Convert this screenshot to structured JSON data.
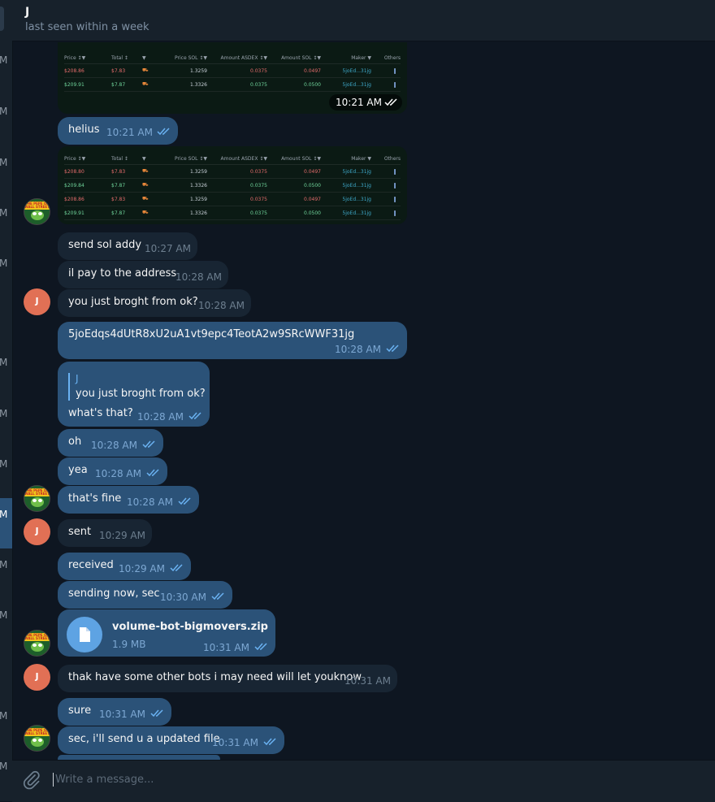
{
  "chat": {
    "name": "J",
    "status": "last seen within a week"
  },
  "composer": {
    "placeholder": "Write a message..."
  },
  "left_strip_marks": [
    "M",
    "M",
    "M",
    "M",
    "M",
    "M",
    "M",
    "M",
    "M",
    "M",
    "M",
    "M",
    "M"
  ],
  "image1": {
    "time": "10:21 AM",
    "headers": [
      "Price ↕▼",
      "Total ↕",
      "▼",
      "Price SOL ↕▼",
      "Amount ASDEX ↕▼",
      "Amount SOL ↕▼",
      "Maker ▼",
      "Others"
    ],
    "rows": [
      {
        "price": "$208.86",
        "total": "$7.83",
        "price_sol": "1.3259",
        "amount_asdex": "0.0375",
        "amount_sol": "0.0497",
        "maker": "5joEd...31jg",
        "side": "red"
      },
      {
        "price": "$209.91",
        "total": "$7.87",
        "price_sol": "1.3326",
        "amount_asdex": "0.0375",
        "amount_sol": "0.0500",
        "maker": "5joEd...31jg",
        "side": "grn"
      }
    ]
  },
  "image2": {
    "headers": [
      "Price ↕▼",
      "Total ↕",
      "▼",
      "Price SOL ↕▼",
      "Amount ASDEX ↕▼",
      "Amount SOL ↕▼",
      "Maker ▼",
      "Others"
    ],
    "rows": [
      {
        "price": "$208.80",
        "total": "$7.83",
        "price_sol": "1.3259",
        "amount_asdex": "0.0375",
        "amount_sol": "0.0497",
        "maker": "5joEd...31jg",
        "side": "red"
      },
      {
        "price": "$209.84",
        "total": "$7.87",
        "price_sol": "1.3326",
        "amount_asdex": "0.0375",
        "amount_sol": "0.0500",
        "maker": "5joEd...31jg",
        "side": "grn"
      },
      {
        "price": "$208.86",
        "total": "$7.83",
        "price_sol": "1.3259",
        "amount_asdex": "0.0375",
        "amount_sol": "0.0497",
        "maker": "5joEd...31jg",
        "side": "red"
      },
      {
        "price": "$209.91",
        "total": "$7.87",
        "price_sol": "1.3326",
        "amount_asdex": "0.0375",
        "amount_sol": "0.0500",
        "maker": "5joEd...31jg",
        "side": "grn"
      }
    ]
  },
  "messages": {
    "helius": {
      "text": "helius",
      "time": "10:21 AM"
    },
    "send_sol": {
      "text": "send sol addy",
      "time": "10:27 AM"
    },
    "il_pay": {
      "text": "il pay to the address",
      "time": "10:28 AM"
    },
    "broght": {
      "text": "you just broght from ok?",
      "time": "10:28 AM"
    },
    "address": {
      "text": "5joEdqs4dUtR8xU2uA1vt9epc4TeotA2w9SRcWWF31jg",
      "time": "10:28 AM"
    },
    "reply": {
      "author": "J",
      "quote": "you just broght from ok?",
      "text": "what's that?",
      "time": "10:28 AM"
    },
    "oh": {
      "text": "oh",
      "time": "10:28 AM"
    },
    "yea": {
      "text": "yea",
      "time": "10:28 AM"
    },
    "fine": {
      "text": "that's fine",
      "time": "10:28 AM"
    },
    "sent": {
      "text": "sent",
      "time": "10:29 AM"
    },
    "received": {
      "text": "received",
      "time": "10:29 AM"
    },
    "sending": {
      "text": "sending now, sec",
      "time": "10:30 AM"
    },
    "file": {
      "name": "volume-bot-bigmovers.zip",
      "size": "1.9 MB",
      "time": "10:31 AM"
    },
    "thak": {
      "text": "thak have some other bots i may need will let youknow",
      "time": "10:31 AM"
    },
    "sure": {
      "text": "sure",
      "time": "10:31 AM"
    },
    "updated": {
      "text": "sec, i'll send u a updated file",
      "time": "10:31 AM"
    }
  },
  "avatars": {
    "j_initial": "J",
    "pepe_text": "THE PEPE OF WALL STREET"
  },
  "colors": {
    "background": "#0e1621",
    "outgoing": "#2b5278",
    "incoming": "#182533",
    "accent": "#6ab2f2",
    "avatar_j": "#e17055"
  }
}
